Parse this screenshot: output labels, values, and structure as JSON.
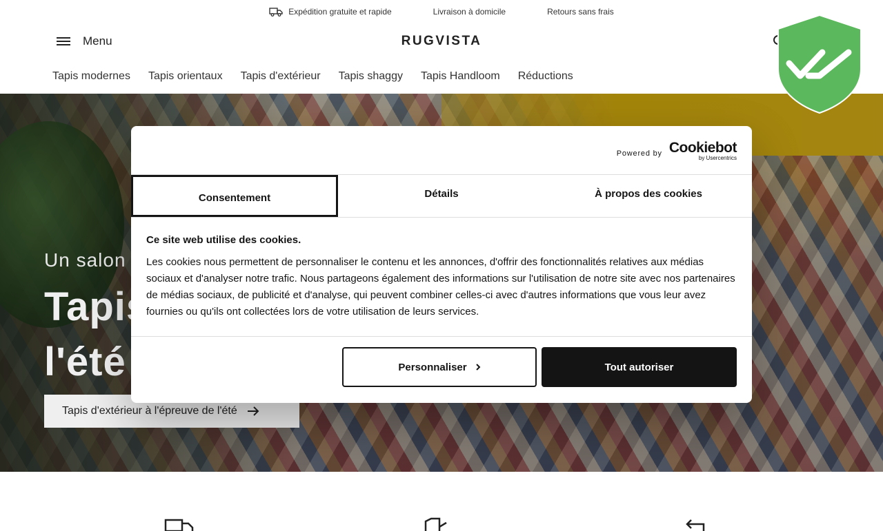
{
  "topbar": {
    "perks": [
      "Expédition gratuite et rapide",
      "Livraison à domicile",
      "Retours sans frais"
    ]
  },
  "header": {
    "menu_label": "Menu",
    "logo": "RUGVISTA"
  },
  "categories": [
    "Tapis modernes",
    "Tapis orientaux",
    "Tapis d'extérieur",
    "Tapis shaggy",
    "Tapis Handloom",
    "Réductions"
  ],
  "hero": {
    "subtitle": "Un salon",
    "title_line1": "Tapis",
    "title_line2": "l'été",
    "cta": "Tapis d'extérieur à l'épreuve de l'été"
  },
  "cookie_dialog": {
    "powered_by": "Powered by",
    "brand": "Cookiebot",
    "brand_sub": "by Usercentrics",
    "tabs": [
      "Consentement",
      "Détails",
      "À propos des cookies"
    ],
    "active_tab": "Consentement",
    "heading": "Ce site web utilise des cookies.",
    "text": "Les cookies nous permettent de personnaliser le contenu et les annonces, d'offrir des fonctionnalités relatives aux médias sociaux et d'analyser notre trafic. Nous partageons également des informations sur l'utilisation de notre site avec nos partenaires de médias sociaux, de publicité et d'analyse, qui peuvent combiner celles-ci avec d'autres informations que vous leur avez fournies ou qu'ils ont collectées lors de votre utilisation de leurs services.",
    "customize_label": "Personnaliser",
    "allow_all_label": "Tout autoriser"
  },
  "colors": {
    "dialog_dark": "#141414",
    "shield_green": "#5cb85c"
  }
}
